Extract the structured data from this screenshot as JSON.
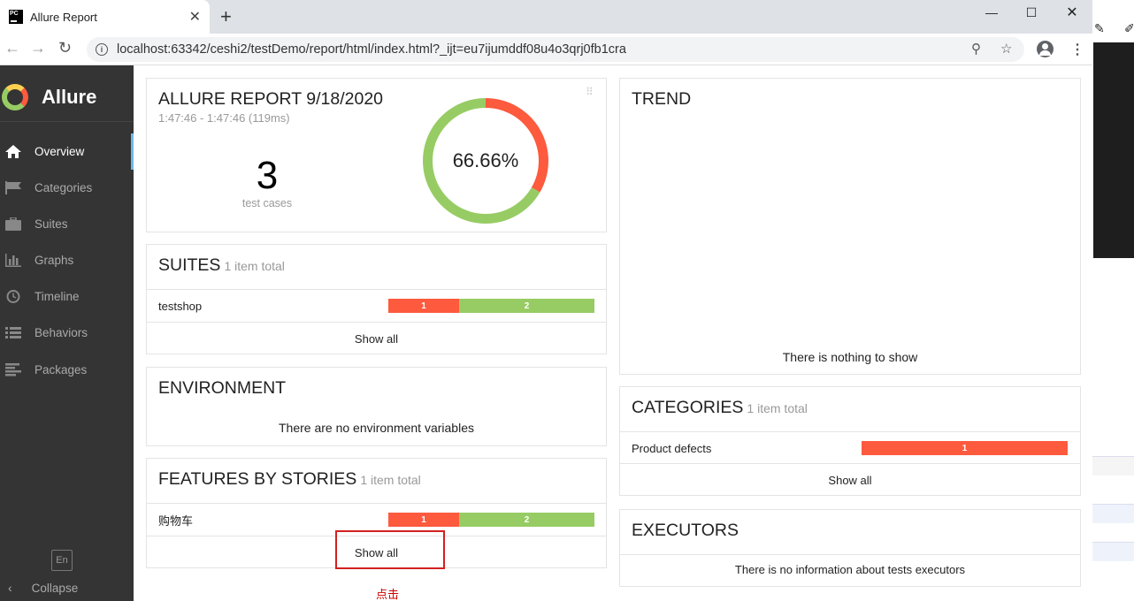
{
  "browser": {
    "tab_title": "Allure Report",
    "tab_icon_text": "PC",
    "url": "localhost:63342/ceshi2/testDemo/report/html/index.html?_ijt=eu7ijumddf08u4o3qrj0fb1cra"
  },
  "sidebar": {
    "brand": "Allure",
    "items": [
      {
        "label": "Overview",
        "icon": "home-icon"
      },
      {
        "label": "Categories",
        "icon": "flag-icon"
      },
      {
        "label": "Suites",
        "icon": "briefcase-icon"
      },
      {
        "label": "Graphs",
        "icon": "bar-chart-icon"
      },
      {
        "label": "Timeline",
        "icon": "clock-icon"
      },
      {
        "label": "Behaviors",
        "icon": "list-icon"
      },
      {
        "label": "Packages",
        "icon": "align-left-icon"
      }
    ],
    "lang": "En",
    "collapse": "Collapse"
  },
  "summary": {
    "title": "ALLURE REPORT 9/18/2020",
    "time": "1:47:46 - 1:47:46 (119ms)",
    "count": "3",
    "count_label": "test cases",
    "percent": "66.66%",
    "passed_fraction": 0.6666,
    "failed_fraction": 0.3334
  },
  "suites": {
    "title": "SUITES",
    "subtitle": "1 item total",
    "rows": [
      {
        "name": "testshop",
        "failed": "1",
        "passed": "2"
      }
    ],
    "show_all": "Show all"
  },
  "environment": {
    "title": "ENVIRONMENT",
    "message": "There are no environment variables"
  },
  "features": {
    "title": "FEATURES BY STORIES",
    "subtitle": "1 item total",
    "rows": [
      {
        "name": "购物车",
        "failed": "1",
        "passed": "2"
      }
    ],
    "show_all": "Show all",
    "annotation": "点击"
  },
  "trend": {
    "title": "TREND",
    "message": "There is nothing to show"
  },
  "categories": {
    "title": "CATEGORIES",
    "subtitle": "1 item total",
    "rows": [
      {
        "name": "Product defects",
        "count": "1"
      }
    ],
    "show_all": "Show all"
  },
  "executors": {
    "title": "EXECUTORS",
    "message": "There is no information about tests executors"
  },
  "colors": {
    "failed": "#fd5a3e",
    "passed": "#97cc64",
    "sidebar": "#343434",
    "accent": "#6eb8ea",
    "annotation": "#cc0000"
  }
}
